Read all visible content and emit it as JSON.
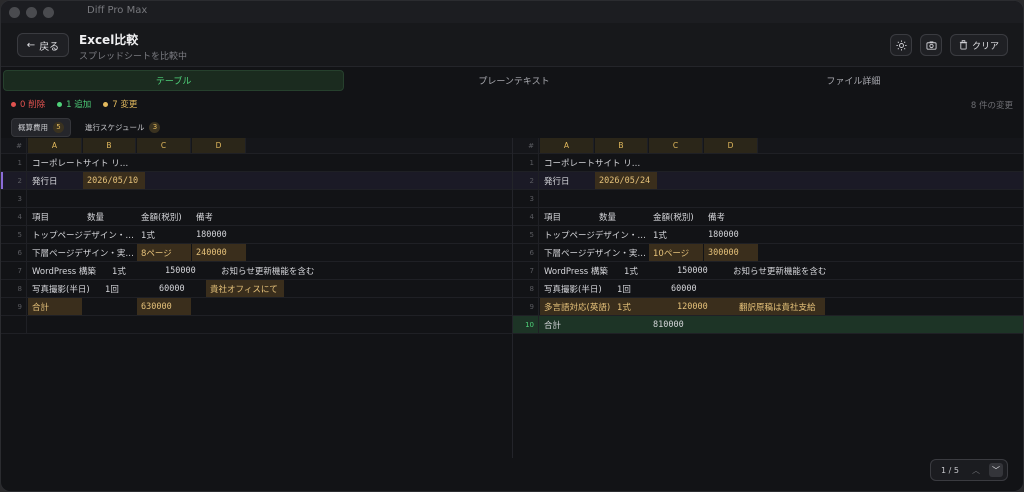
{
  "app": {
    "title": "Diff Pro Max"
  },
  "header": {
    "back_label": "戻る",
    "title": "Excel比較",
    "subtitle": "スプレッドシートを比較中",
    "clear_label": "クリア"
  },
  "tabs": [
    {
      "label": "テーブル",
      "active": true
    },
    {
      "label": "プレーンテキスト",
      "active": false
    },
    {
      "label": "ファイル詳細",
      "active": false
    }
  ],
  "stats": {
    "removed": "0 削除",
    "added": "1 追加",
    "changed": "7 変更",
    "total": "8 件の変更",
    "colors": {
      "removed": "#e0524f",
      "added": "#4fd27a",
      "changed": "#e2b95d"
    }
  },
  "sheets": [
    {
      "label": "概算費用",
      "count": "5",
      "active": true
    },
    {
      "label": "進行スケジュール",
      "count": "3",
      "active": false
    }
  ],
  "grid_left": {
    "hash": "#",
    "columns": [
      "A",
      "B",
      "C",
      "D"
    ],
    "rows": [
      {
        "n": "1",
        "a": "コーポレートサイト リ…",
        "b": "",
        "c": "",
        "d": ""
      },
      {
        "n": "2",
        "a": "発行日",
        "b": "2026/05/10",
        "c": "",
        "d": ""
      },
      {
        "n": "3",
        "a": "",
        "b": "",
        "c": "",
        "d": ""
      },
      {
        "n": "4",
        "a": "項目",
        "b": "数量",
        "c": "金額(税別)",
        "d": "備考"
      },
      {
        "n": "5",
        "a": "トップページデザイン・…",
        "b": "",
        "c": "1式",
        "d": "180000"
      },
      {
        "n": "6",
        "a": "下層ページデザイン・実…",
        "b": "",
        "c": "8ページ",
        "d": "240000"
      },
      {
        "n": "7",
        "a": "WordPress 構築",
        "b": "1式",
        "c": "150000",
        "d": "お知らせ更新機能を含む"
      },
      {
        "n": "8",
        "a": "写真撮影(半日)",
        "b": "1回",
        "c": "60000",
        "d": "貴社オフィスにて"
      },
      {
        "n": "9",
        "a": "合計",
        "b": "",
        "c": "630000",
        "d": ""
      }
    ]
  },
  "grid_right": {
    "hash": "#",
    "columns": [
      "A",
      "B",
      "C",
      "D"
    ],
    "rows": [
      {
        "n": "1",
        "a": "コーポレートサイト リ…",
        "b": "",
        "c": "",
        "d": ""
      },
      {
        "n": "2",
        "a": "発行日",
        "b": "2026/05/24",
        "c": "",
        "d": ""
      },
      {
        "n": "3",
        "a": "",
        "b": "",
        "c": "",
        "d": ""
      },
      {
        "n": "4",
        "a": "項目",
        "b": "数量",
        "c": "金額(税別)",
        "d": "備考"
      },
      {
        "n": "5",
        "a": "トップページデザイン・…",
        "b": "",
        "c": "1式",
        "d": "180000"
      },
      {
        "n": "6",
        "a": "下層ページデザイン・実…",
        "b": "",
        "c": "10ページ",
        "d": "300000"
      },
      {
        "n": "7",
        "a": "WordPress 構築",
        "b": "1式",
        "c": "150000",
        "d": "お知らせ更新機能を含む"
      },
      {
        "n": "8",
        "a": "写真撮影(半日)",
        "b": "1回",
        "c": "60000",
        "d": ""
      },
      {
        "n": "9",
        "a": "多言語対応(英語)",
        "b": "1式",
        "c": "120000",
        "d": "翻訳原稿は貴社支給"
      },
      {
        "n": "10",
        "a": "合計",
        "b": "",
        "c": "810000",
        "d": ""
      }
    ]
  },
  "pager": {
    "text": "1 / 5"
  }
}
